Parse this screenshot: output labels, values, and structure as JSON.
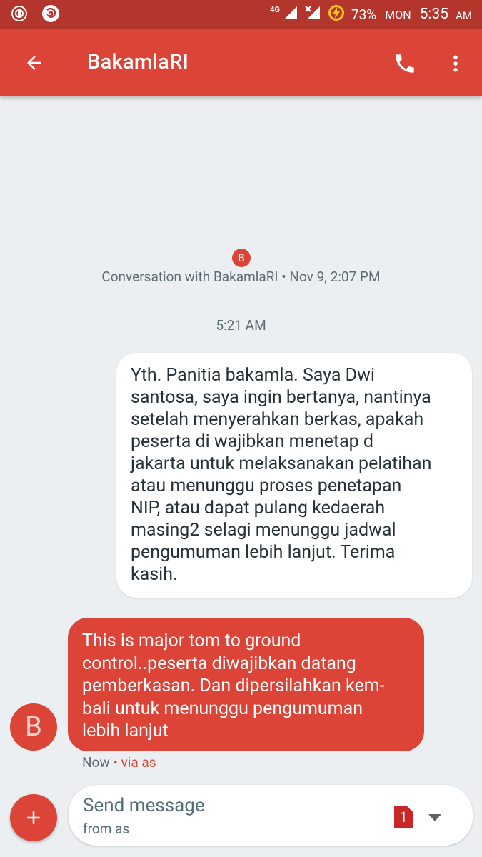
{
  "status_bar": {
    "network": "4G",
    "battery_percent": "73%",
    "day": "MON",
    "time": "5:35",
    "ampm": "AM"
  },
  "app_bar": {
    "title": "BakamlaRI",
    "back_icon": "arrow-back-icon",
    "call_icon": "phone-icon",
    "more_icon": "more-vert-icon"
  },
  "conversation": {
    "avatar_letter": "B",
    "header": "Conversation with BakamlaRI • Nov 9, 2:07 PM",
    "timestamp": "5:21 AM"
  },
  "messages": [
    {
      "direction": "outgoing",
      "text": "Yth. Panitia bakamla. Saya Dwi\nsantosa, saya ingin bertanya, nantinya\nsetelah menyerahkan berkas, apakah\npeserta di wajibkan menetap d\njakarta untuk melaksanakan pelatihan\natau menunggu proses penetapan\nNIP, atau dapat pulang kedaerah\nmasing2 selagi menunggu jadwal\npengumuman lebih lanjut. Terima\nkasih."
    },
    {
      "direction": "incoming",
      "avatar_letter": "B",
      "text": "This is major tom to ground\ncontrol..peserta diwajibkan datang\npemberkasan. Dan dipersilahkan kem-\nbali untuk menunggu pengumuman\nlebih lanjut",
      "time": "Now",
      "via": " • via as"
    }
  ],
  "compose": {
    "placeholder": "Send message",
    "from": "from as",
    "sim_number": "1"
  },
  "colors": {
    "status_bar": "#b3352b",
    "accent": "#db4437",
    "background": "#eceff1"
  }
}
